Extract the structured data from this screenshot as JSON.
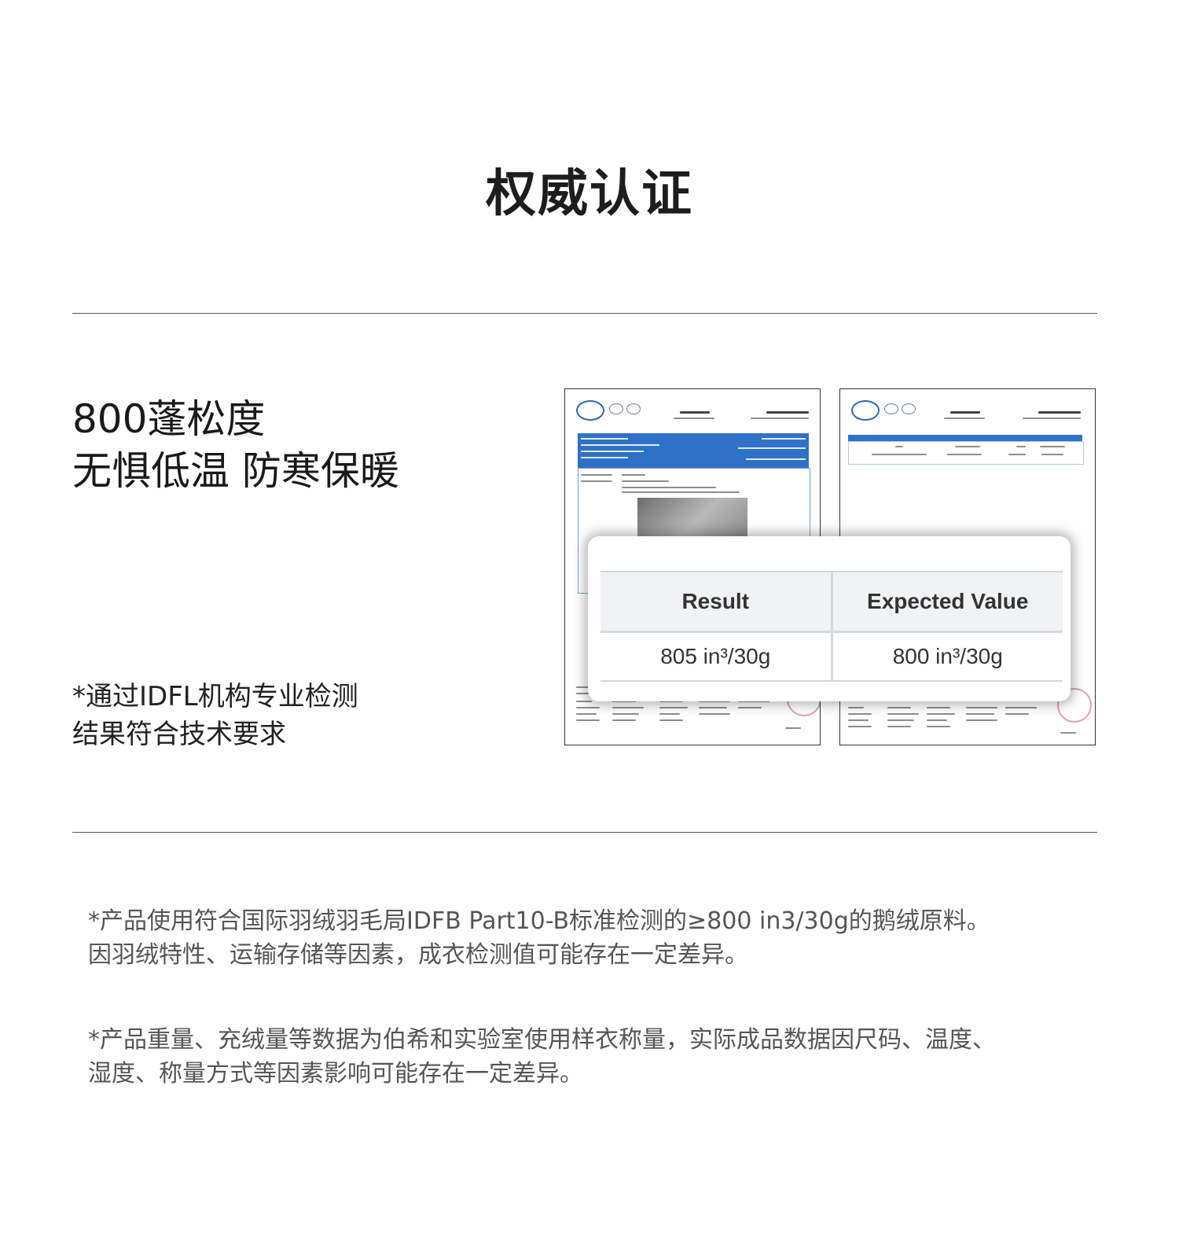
{
  "page_title": "权威认证",
  "headline": {
    "line1": "800蓬松度",
    "line2": "无惧低温 防寒保暖"
  },
  "cert_note": {
    "line1": "*通过IDFL机构专业检测",
    "line2": "结果符合技术要求"
  },
  "result_table": {
    "headers": [
      "Result",
      "Expected Value"
    ],
    "values": [
      "805 in³/30g",
      "800 in³/30g"
    ]
  },
  "footnotes": [
    {
      "line1": "*产品使用符合国际羽绒羽毛局IDFB Part10-B标准检测的≥800 in3/30g的鹅绒原料。",
      "line2": "因羽绒特性、运输存储等因素，成衣检测值可能存在一定差异。"
    },
    {
      "line1": "*产品重量、充绒量等数据为伯希和实验室使用样衣称量，实际成品数据因尺码、温度、",
      "line2": "湿度、称量方式等因素影响可能存在一定差异。"
    }
  ],
  "colors": {
    "report_blue": "#2f71c7",
    "divider": "#555555"
  }
}
